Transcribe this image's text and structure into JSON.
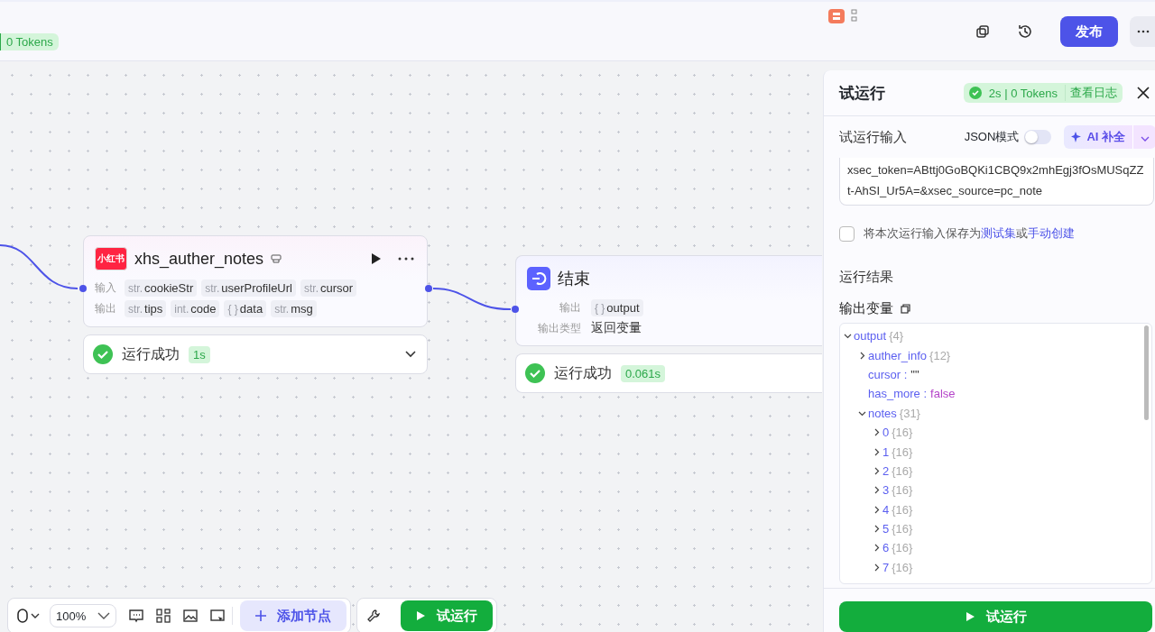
{
  "header": {
    "token_badge": "0 Tokens",
    "publish_button": "发布"
  },
  "nodes": [
    {
      "kind": "plugin",
      "title": "xhs_auther_notes",
      "logo": "小红书",
      "inputs_label": "输入",
      "inputs": [
        {
          "type": "str.",
          "name": "cookieStr"
        },
        {
          "type": "str.",
          "name": "userProfileUrl"
        },
        {
          "type": "str.",
          "name": "cursor"
        }
      ],
      "outputs_label": "输出",
      "outputs": [
        {
          "type": "str.",
          "name": "tips"
        },
        {
          "type": "int.",
          "name": "code"
        },
        {
          "type": "{ }",
          "name": "data"
        },
        {
          "type": "str.",
          "name": "msg"
        }
      ],
      "status": {
        "text": "运行成功",
        "time": "1s",
        "expanded": false
      }
    },
    {
      "kind": "end",
      "title": "结束",
      "outputs_label": "输出",
      "outputs": [
        {
          "type": "{ }",
          "name": "output"
        }
      ],
      "output_type_label": "输出类型",
      "output_type": "返回变量",
      "status": {
        "text": "运行成功",
        "time": "0.061s"
      }
    }
  ],
  "run_panel": {
    "title": "试运行",
    "badge": {
      "stats": "2s | 0 Tokens",
      "link": "查看日志"
    },
    "input_label": "试运行输入",
    "json_mode": {
      "label": "JSON模式",
      "on": false
    },
    "ai_button": "AI 补全",
    "input_value": "xsec_token=ABttj0GoBQKi1CBQ9x2mhEgj3fOsMUSqZZt-AhSI_Ur5A=&xsec_source=pc_note",
    "save_option": {
      "checked": false,
      "text": "将本次运行输入保存为",
      "link1": "测试集",
      "middle": "或",
      "link2": "手动创建"
    },
    "result_title": "运行结果",
    "output_vars_label": "输出变量",
    "tree": [
      {
        "kind": "object",
        "key": "output",
        "count": "{4}",
        "expanded": true,
        "children": [
          {
            "kind": "object",
            "key": "auther_info",
            "count": "{12}",
            "expanded": false
          },
          {
            "kind": "string",
            "key": "cursor :",
            "value": "\"\""
          },
          {
            "kind": "boolean",
            "key": "has_more :",
            "value": "false"
          },
          {
            "kind": "object",
            "key": "notes",
            "count": "{31}",
            "expanded": true,
            "children": [
              {
                "kind": "object",
                "key": "0",
                "count": "{16}",
                "expanded": false
              },
              {
                "kind": "object",
                "key": "1",
                "count": "{16}",
                "expanded": false
              },
              {
                "kind": "object",
                "key": "2",
                "count": "{16}",
                "expanded": false
              },
              {
                "kind": "object",
                "key": "3",
                "count": "{16}",
                "expanded": false
              },
              {
                "kind": "object",
                "key": "4",
                "count": "{16}",
                "expanded": false
              },
              {
                "kind": "object",
                "key": "5",
                "count": "{16}",
                "expanded": false
              },
              {
                "kind": "object",
                "key": "6",
                "count": "{16}",
                "expanded": false
              },
              {
                "kind": "object",
                "key": "7",
                "count": "{16}",
                "expanded": false
              }
            ]
          }
        ]
      }
    ],
    "run_button": "试运行"
  },
  "toolbar": {
    "zoom": "100%",
    "add_node": "添加节点",
    "run_button": "试运行"
  }
}
